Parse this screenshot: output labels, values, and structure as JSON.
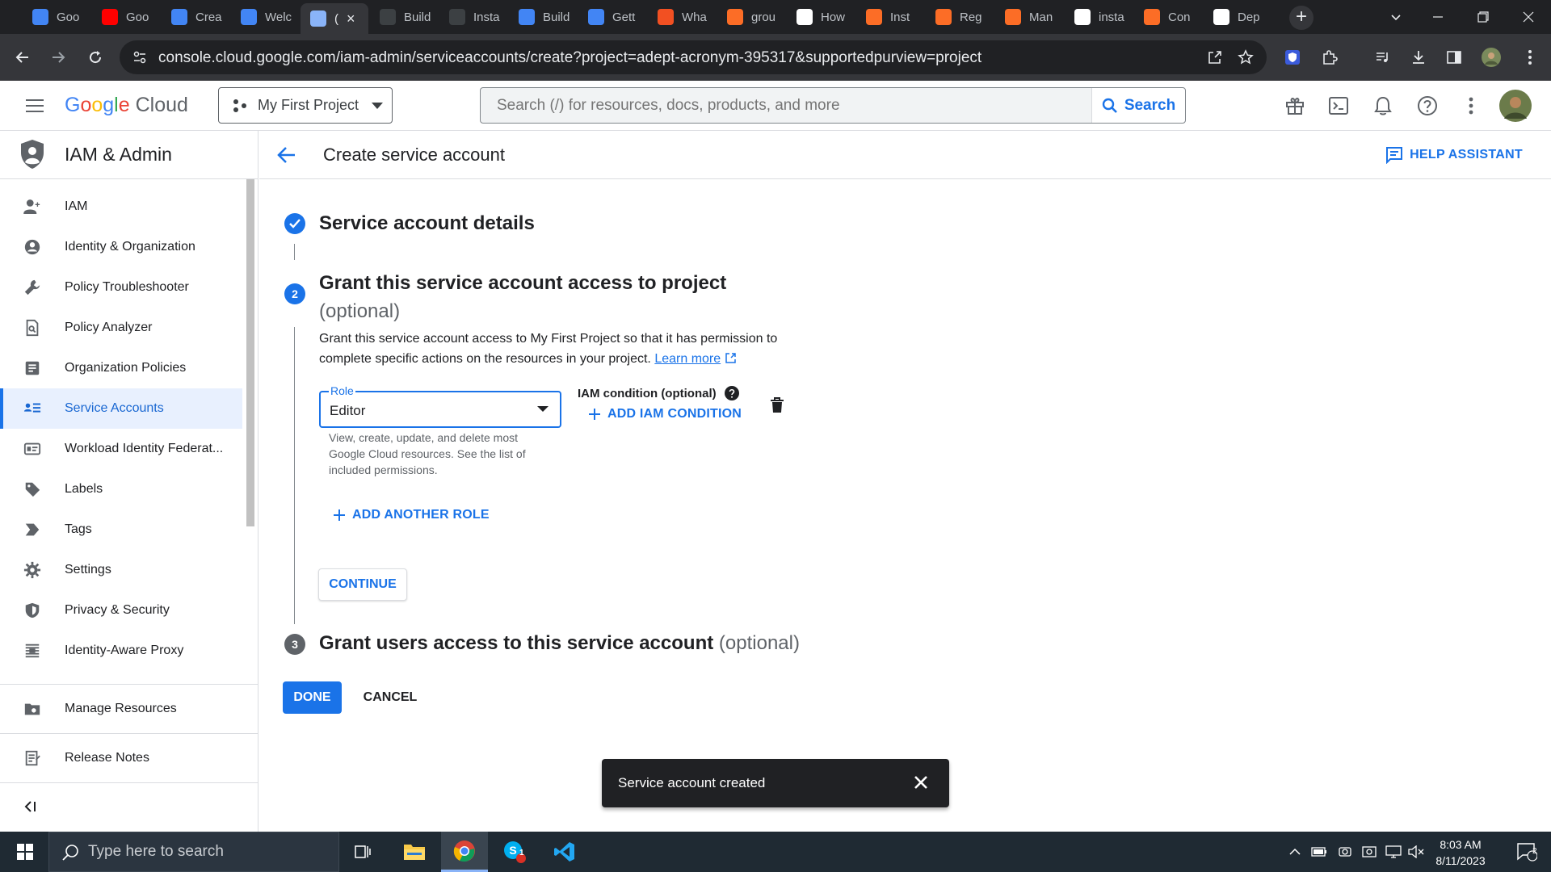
{
  "browser": {
    "tabs": [
      {
        "label": "Goo",
        "icon": "google-cloud-icon",
        "color": "#4285f4"
      },
      {
        "label": "Goo",
        "icon": "youtube-icon",
        "color": "#ff0000"
      },
      {
        "label": "Crea",
        "icon": "google-cloud-icon",
        "color": "#4285f4"
      },
      {
        "label": "Welc",
        "icon": "google-cloud-icon",
        "color": "#4285f4"
      },
      {
        "label": "(",
        "icon": "iam-shield-icon",
        "color": "#8ab4f8",
        "active": true
      },
      {
        "label": "Build",
        "icon": "hashnode-icon",
        "color": "#3c4043"
      },
      {
        "label": "Insta",
        "icon": "hashnode-icon",
        "color": "#3c4043"
      },
      {
        "label": "Build",
        "icon": "google-cloud-icon",
        "color": "#4285f4"
      },
      {
        "label": "Gett",
        "icon": "google-cloud-icon",
        "color": "#4285f4"
      },
      {
        "label": "Wha",
        "icon": "microsoft-icon",
        "color": "#f25022"
      },
      {
        "label": "grou",
        "icon": "gitlab-icon",
        "color": "#fc6d26"
      },
      {
        "label": "How",
        "icon": "medium-icon",
        "color": "#ffffff"
      },
      {
        "label": "Inst",
        "icon": "gitlab-icon",
        "color": "#fc6d26"
      },
      {
        "label": "Reg",
        "icon": "gitlab-icon",
        "color": "#fc6d26"
      },
      {
        "label": "Man",
        "icon": "gitlab-icon",
        "color": "#fc6d26"
      },
      {
        "label": "insta",
        "icon": "packagecloud-icon",
        "color": "#ffffff"
      },
      {
        "label": "Con",
        "icon": "gitlab-icon",
        "color": "#fc6d26"
      },
      {
        "label": "Dep",
        "icon": "medium-icon",
        "color": "#ffffff"
      }
    ],
    "url": "console.cloud.google.com/iam-admin/serviceaccounts/create?project=adept-acronym-395317&supportedpurview=project"
  },
  "header": {
    "logo_google": "Google",
    "logo_cloud": "Cloud",
    "project": "My First Project",
    "search_placeholder": "Search (/) for resources, docs, products, and more",
    "search_button": "Search"
  },
  "sidebar": {
    "title": "IAM & Admin",
    "items": [
      {
        "label": "IAM",
        "icon": "person-add-icon"
      },
      {
        "label": "Identity & Organization",
        "icon": "account-circle-icon"
      },
      {
        "label": "Policy Troubleshooter",
        "icon": "wrench-icon"
      },
      {
        "label": "Policy Analyzer",
        "icon": "document-search-icon"
      },
      {
        "label": "Organization Policies",
        "icon": "list-box-icon"
      },
      {
        "label": "Service Accounts",
        "icon": "service-account-icon",
        "active": true
      },
      {
        "label": "Workload Identity Federat...",
        "icon": "id-card-icon"
      },
      {
        "label": "Labels",
        "icon": "label-icon"
      },
      {
        "label": "Tags",
        "icon": "tag-arrow-icon"
      },
      {
        "label": "Settings",
        "icon": "gear-icon"
      },
      {
        "label": "Privacy & Security",
        "icon": "shield-icon"
      },
      {
        "label": "Identity-Aware Proxy",
        "icon": "proxy-icon"
      }
    ],
    "bottom_items": [
      {
        "label": "Manage Resources",
        "icon": "folder-settings-icon"
      },
      {
        "label": "Release Notes",
        "icon": "release-notes-icon"
      }
    ]
  },
  "page": {
    "title": "Create service account",
    "help_assistant": "HELP ASSISTANT",
    "step1": {
      "title": "Service account details"
    },
    "step2": {
      "number": "2",
      "title": "Grant this service account access to project",
      "optional": "(optional)",
      "description": "Grant this service account access to My First Project so that it has permission to complete specific actions on the resources in your project.",
      "learn_more": "Learn more",
      "role_label": "Role",
      "role_value": "Editor",
      "role_hint": "View, create, update, and delete most Google Cloud resources. See the list of included permissions.",
      "iam_condition_label": "IAM condition (optional)",
      "add_condition": "ADD IAM CONDITION",
      "add_role": "ADD ANOTHER ROLE",
      "continue": "CONTINUE"
    },
    "step3": {
      "number": "3",
      "title": "Grant users access to this service account",
      "optional": "(optional)"
    },
    "done": "DONE",
    "cancel": "CANCEL"
  },
  "snackbar": {
    "message": "Service account created"
  },
  "taskbar": {
    "search_placeholder": "Type here to search",
    "time": "8:03 AM",
    "date": "8/11/2023",
    "notification_count": "2",
    "skype_badge": "1"
  },
  "colors": {
    "accent": "#1a73e8",
    "sidebar_active_bg": "#e8f0fe",
    "snackbar_bg": "#202124"
  }
}
